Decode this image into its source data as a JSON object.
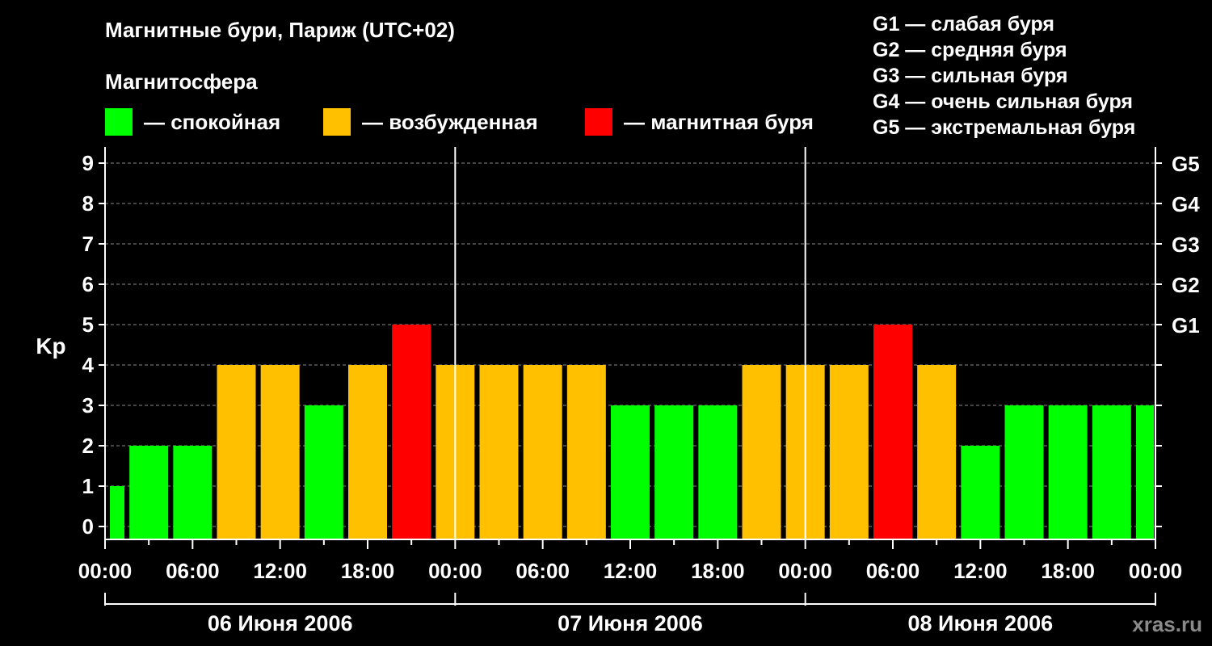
{
  "chart_data": {
    "type": "bar",
    "title": "Магнитные бури, Париж (UTC+02)",
    "subtitle": "Магнитосфера",
    "ylabel": "Kp",
    "ylim": [
      0,
      9
    ],
    "y_ticks": [
      "0",
      "1",
      "2",
      "3",
      "4",
      "5",
      "6",
      "7",
      "8",
      "9"
    ],
    "right_ticks": [
      {
        "value": 5,
        "label": "G1"
      },
      {
        "value": 6,
        "label": "G2"
      },
      {
        "value": 7,
        "label": "G3"
      },
      {
        "value": 8,
        "label": "G4"
      },
      {
        "value": 9,
        "label": "G5"
      }
    ],
    "grid": "dashed horizontal",
    "x_tick_labels": [
      "00:00",
      "06:00",
      "12:00",
      "18:00",
      "00:00",
      "06:00",
      "12:00",
      "18:00",
      "00:00",
      "06:00",
      "12:00",
      "18:00",
      "00:00"
    ],
    "days": [
      "06 Июня 2006",
      "07 Июня 2006",
      "08 Июня 2006"
    ],
    "interval_hours": 3,
    "values": [
      1,
      2,
      2,
      4,
      4,
      3,
      4,
      5,
      4,
      4,
      4,
      4,
      3,
      3,
      3,
      4,
      4,
      4,
      5,
      4,
      2,
      3,
      3,
      3,
      3
    ],
    "legend": [
      {
        "label": "— спокойная",
        "color": "#00ff00"
      },
      {
        "label": "— возбужденная",
        "color": "#ffc000"
      },
      {
        "label": "— магнитная буря",
        "color": "#ff0000"
      }
    ],
    "storm_levels": [
      "G1 — слабая буря",
      "G2 — средняя буря",
      "G3 — сильная буря",
      "G4 — очень сильная буря",
      "G5 — экстремальная буря"
    ],
    "colors": {
      "calm": "#00ff00",
      "excited": "#ffc000",
      "storm": "#ff0000"
    }
  },
  "footer": "xras.ru"
}
